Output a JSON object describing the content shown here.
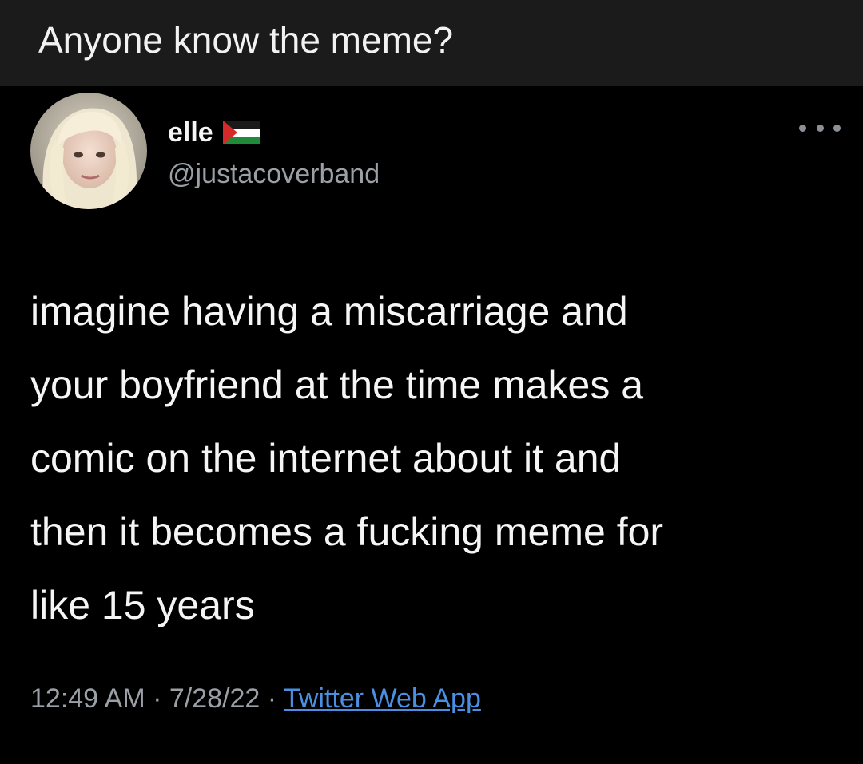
{
  "caption": {
    "text": "Anyone know the meme?"
  },
  "tweet": {
    "display_name": "elle",
    "handle": "@justacoverband",
    "body_lines": [
      "imagine having a miscarriage and",
      "your boyfriend at the time makes a",
      "comic on the internet about it and",
      "then it becomes a fucking meme for",
      "like 15 years"
    ],
    "time": "12:49 AM",
    "separator": " · ",
    "date": "7/28/22",
    "source": "Twitter Web App",
    "icons": {
      "more": "more-options-icon",
      "flag": "palestine-flag-icon"
    }
  },
  "colors": {
    "background": "#000000",
    "caption_bar": "#1b1b1b",
    "text": "#f5f5f5",
    "muted": "#9aa0a6",
    "link": "#4a90e2"
  }
}
